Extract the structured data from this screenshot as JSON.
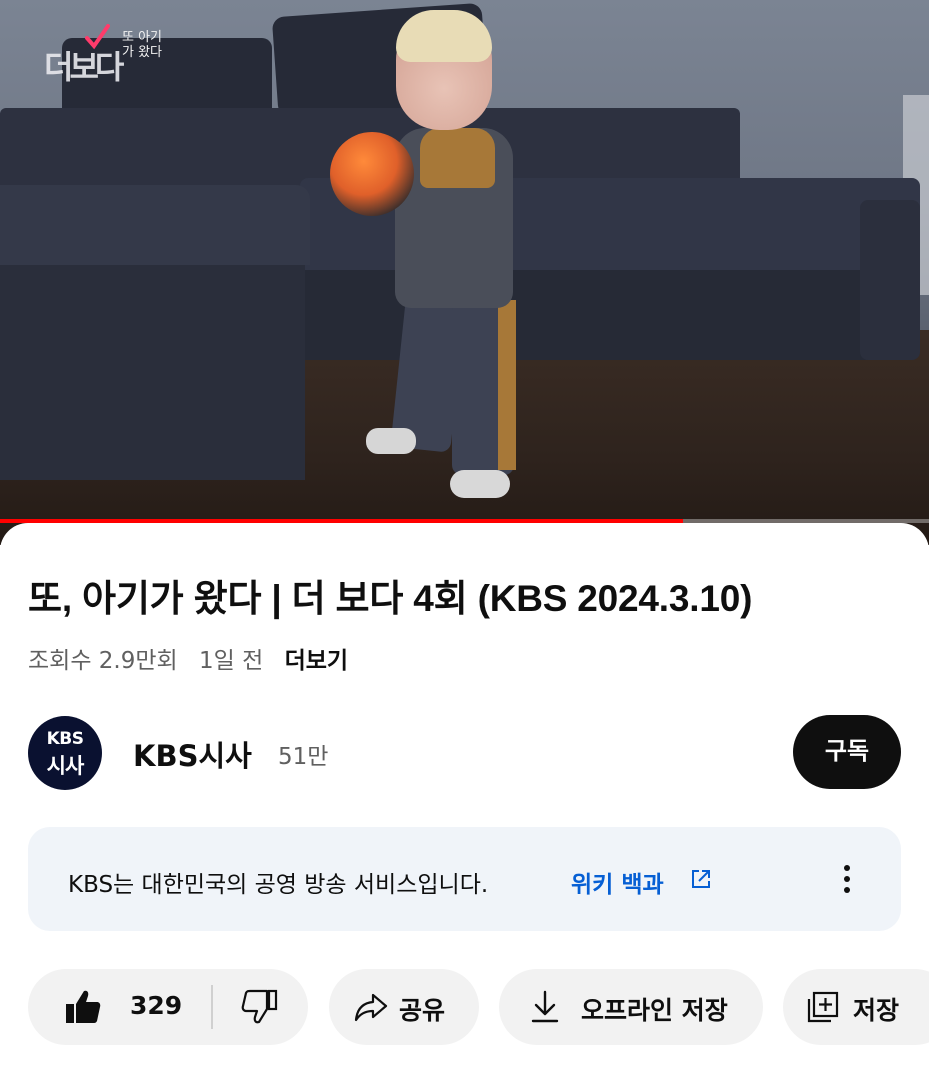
{
  "video": {
    "overlay_logo_big": "더보다",
    "overlay_logo_small": "또 아기가 왔다",
    "progress_fraction": 0.735
  },
  "title": "또, 아기가 왔다 | 더 보다 4회 (KBS 2024.3.10)",
  "meta": {
    "views": "조회수 2.9만회",
    "age": "1일 전",
    "more": "더보기"
  },
  "channel": {
    "avatar_line1": "KBS",
    "avatar_line2": "시사",
    "name": "KBS시사",
    "subscribers": "51만",
    "subscribe_label": "구독"
  },
  "info_panel": {
    "text": "KBS는 대한민국의 공영 방송 서비스입니다.",
    "link": "위키 백과"
  },
  "actions": {
    "like_count": "329",
    "share_label": "공유",
    "download_label": "오프라인 저장",
    "save_label": "저장"
  },
  "icons": {
    "like": "thumbs-up-icon",
    "dislike": "thumbs-down-icon",
    "share": "share-arrow-icon",
    "download": "download-icon",
    "save": "playlist-add-icon",
    "external": "external-link-icon",
    "menu": "more-vert-icon"
  },
  "colors": {
    "progress": "#ff0000",
    "link": "#065fd4",
    "subscribe_bg": "#0f0f0f",
    "pill_bg": "#f2f2f2",
    "info_bg": "#f0f4f9"
  }
}
